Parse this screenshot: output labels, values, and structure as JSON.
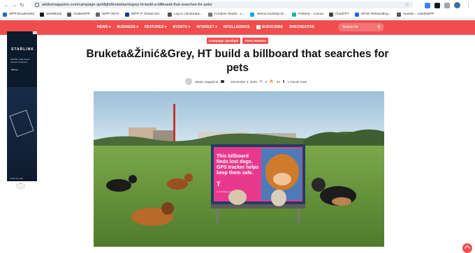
{
  "browser": {
    "url": "adobomagazine.com/campaign-spotlight/bruketaznicgrey-ht-build-a-billboard-that-searches-for-pets/"
  },
  "bookmarks": [
    {
      "label": "WPP Bookmarks",
      "color": "#2b6cb0"
    },
    {
      "label": "WorkBook",
      "color": "#1a1a1a"
    },
    {
      "label": "InsideWPP",
      "color": "#555555"
    },
    {
      "label": "WPP OKTA",
      "color": "#666666"
    },
    {
      "label": "WPP IT Global Ser...",
      "color": "#1e3a8a"
    },
    {
      "label": "Log in | Bruketa&...",
      "color": "#555555"
    },
    {
      "label": "Creative Studio - L...",
      "color": "#777777"
    },
    {
      "label": "Jelena Kartelija Di...",
      "color": "#0ea5e9"
    },
    {
      "label": "Pobirna – Canva",
      "color": "#14b8a6"
    },
    {
      "label": "ChatGPT",
      "color": "#444444"
    },
    {
      "label": "SPAN Rebranding...",
      "color": "#2563eb"
    },
    {
      "label": "Awards – InsideWPP",
      "color": "#555555"
    }
  ],
  "nav": {
    "items": [
      "NEWS",
      "BUSINESS",
      "FEATURES",
      "EVENTS",
      "INTEREST",
      "INTELLIGENCE",
      "SUBSCRIBE",
      "SHECREATIVE"
    ],
    "search_placeholder": "Search for",
    "accent": "#f04e4e"
  },
  "ad": {
    "label": "Ad",
    "brand": "STARLINK",
    "tagline": "Reliable, high-speed internet starting at",
    "price": "$29/mo",
    "footer": "Limited time offer"
  },
  "article": {
    "tags": [
      "Campaign Spotlight",
      "Press Release"
    ],
    "title": "Bruketa&Žinić&Grey, HT build a billboard that searches for pets",
    "author": "adobo magazine",
    "date": "December 3, 2025",
    "comments": "0",
    "views": "23",
    "read_time": "1 minute read"
  },
  "billboard": {
    "line1": "This billboard",
    "line2": "finds lost dogs.",
    "line3": "GPS tracker helps",
    "line4": "keep them safe.",
    "logo": "T",
    "small": "Connecting your world."
  }
}
